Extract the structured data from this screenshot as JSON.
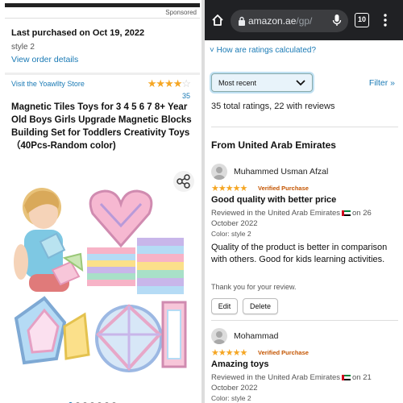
{
  "colors": {
    "link": "#1a7ab5",
    "star": "#f5a623",
    "verified": "#c45500",
    "browser_bar": "#202124"
  },
  "left": {
    "sponsored": "Sponsored",
    "last_purchased": "Last purchased on Oct 19, 2022",
    "style": "style 2",
    "view_order": "View order details",
    "store_link": "Visit the Yoawllty Store",
    "rating_stars": 4,
    "rating_count": "35",
    "product_title": "Magnetic Tiles Toys for 3 4 5 6 7 8+ Year Old Boys Girls Upgrade Magnetic Blocks Building Set for Toddlers Creativity Toys（40Pcs-Random color)",
    "share_icon": "share-icon",
    "carousel_total": 7,
    "carousel_active": 1
  },
  "browser": {
    "url_host": "amazon.ae",
    "url_path": "/gp/",
    "tab_count": "10",
    "icons": [
      "home-icon",
      "lock-icon",
      "mic-icon",
      "tabs-icon",
      "menu-icon"
    ]
  },
  "right": {
    "ratings_calculated": "How are ratings calculated?",
    "sort_value": "Most recent",
    "filter_label": "Filter »",
    "total_ratings": "35 total ratings, 22 with reviews",
    "from_heading": "From United Arab Emirates",
    "reviews": [
      {
        "name": "Muhammed Usman Afzal",
        "stars": "★★★★★",
        "verified": "Verified Purchase",
        "title": "Good quality with better price",
        "reviewed_prefix": "Reviewed in the United Arab Emirates",
        "reviewed_suffix": "on 26 October 2022",
        "color": "Color: style 2",
        "body": "Quality of the product is better in comparison with others. Good for kids learning activities.",
        "helpful": "Thank you for your review.",
        "edit_label": "Edit",
        "delete_label": "Delete"
      },
      {
        "name": "Mohammad",
        "stars": "★★★★★",
        "verified": "Verified Purchase",
        "title": "Amazing toys",
        "reviewed_prefix": "Reviewed in the United Arab Emirates",
        "reviewed_suffix": "on 21 October 2022",
        "color": "Color: style 2"
      }
    ]
  }
}
